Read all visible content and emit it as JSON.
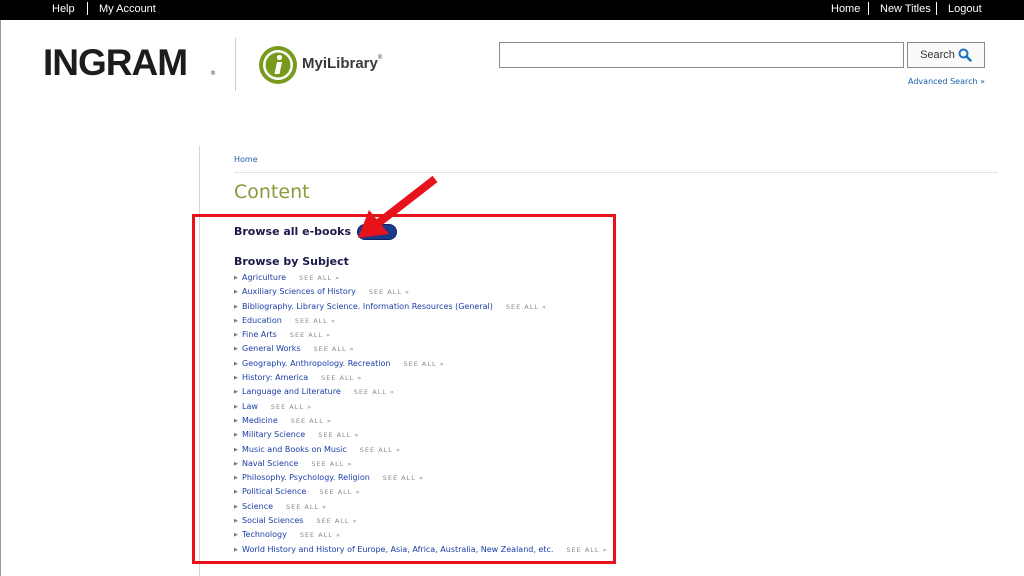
{
  "topbar": {
    "left_links": [
      "Help",
      "My Account"
    ],
    "right_links": [
      "Home",
      "New Titles",
      "Logout"
    ]
  },
  "brand": {
    "ingram": "INGRAM",
    "ingram_reg": "®",
    "product": "MyiLibrary",
    "product_tm": "®"
  },
  "search": {
    "value": "",
    "button_label": "Search",
    "advanced": "Advanced Search »"
  },
  "breadcrumb": "Home",
  "page_title": "Content",
  "browse_all": "Browse all e-books",
  "browse_by_subject": "Browse by Subject",
  "see_all_label": "SEE ALL »",
  "subjects": [
    "Agriculture",
    "Auxiliary Sciences of History",
    "Bibliography. Library Science. Information Resources (General)",
    "Education",
    "Fine Arts",
    "General Works",
    "Geography. Anthropology. Recreation",
    "History: America",
    "Language and Literature",
    "Law",
    "Medicine",
    "Military Science",
    "Music and Books on Music",
    "Naval Science",
    "Philosophy. Psychology. Religion",
    "Political Science",
    "Science",
    "Social Sciences",
    "Technology",
    "World History and History of Europe, Asia, Africa, Australia, New Zealand, etc."
  ],
  "icons": {
    "search": "search-icon",
    "bullet": "triangle-bullet-icon",
    "annotation": "red-arrow-icon"
  },
  "colors": {
    "topbar": "#000000",
    "title": "#8a9a3a",
    "link": "#1a3ea8",
    "highlight": "#e8121b",
    "logo_green": "#7a9a1e"
  }
}
